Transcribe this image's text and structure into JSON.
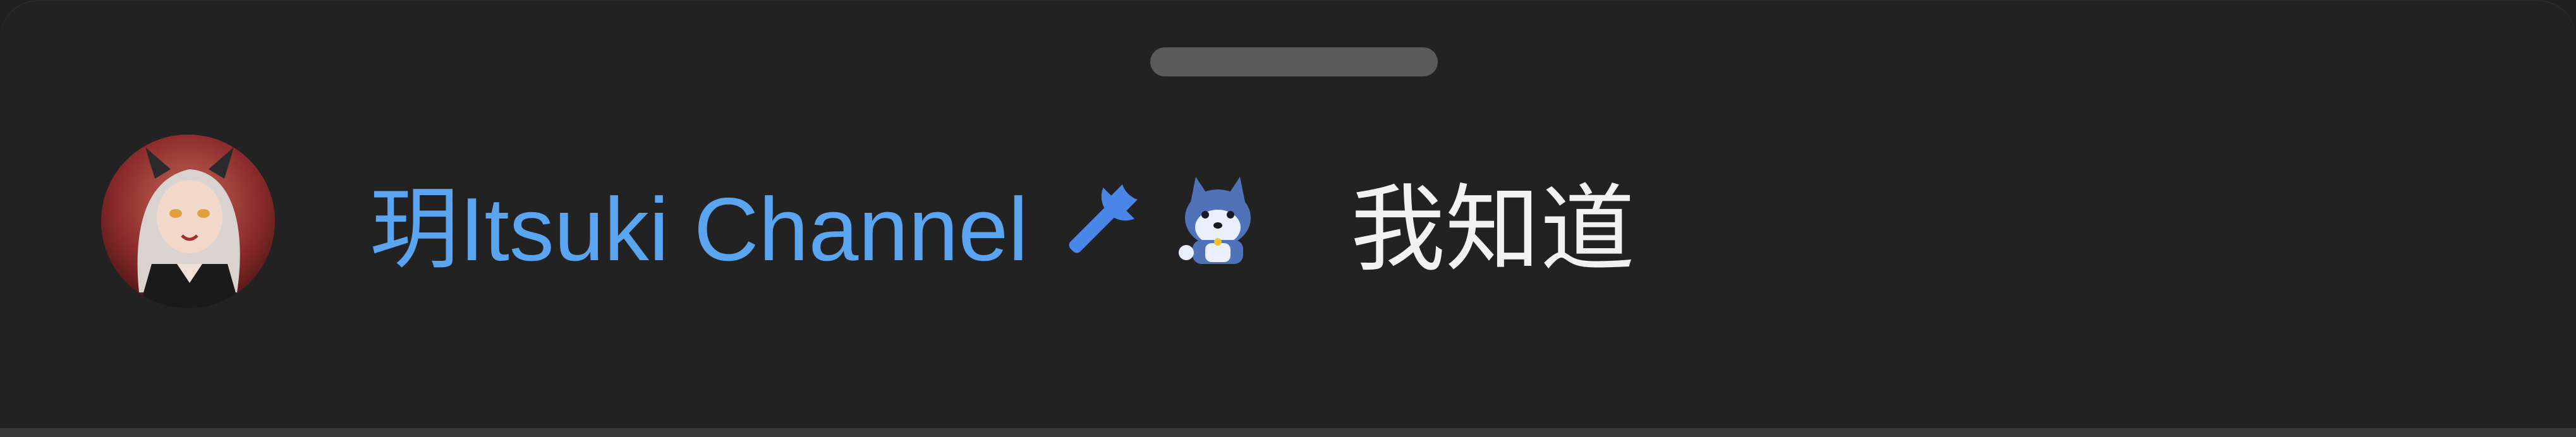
{
  "sheet": {
    "handle_label": ""
  },
  "comment": {
    "avatar_icon": "user-avatar",
    "author": "玥Itsuki Channel",
    "badge_icon": "wrench-icon",
    "emoji_icon": "husky-emoji-icon",
    "message": "我知道"
  },
  "colors": {
    "background": "#222222",
    "author": "#5aa4f0",
    "message": "#f2f2f2",
    "badge": "#4a86e8",
    "handle": "#5a5a5a"
  }
}
